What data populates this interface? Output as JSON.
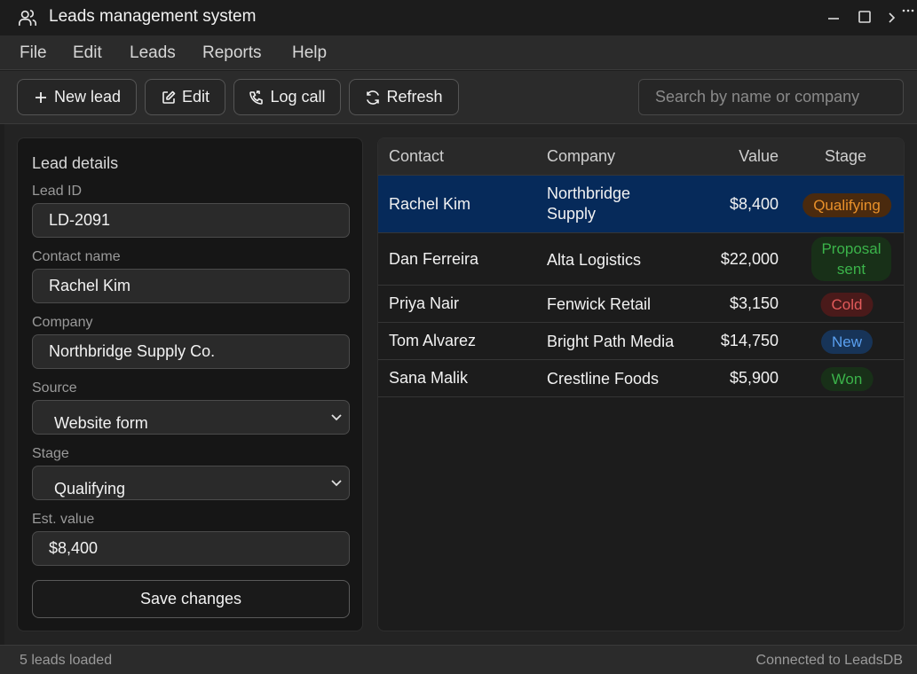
{
  "window": {
    "title": "Leads management system",
    "icon": "users-icon"
  },
  "menu": [
    "File",
    "Edit",
    "Leads",
    "Reports",
    "Help"
  ],
  "toolbar": {
    "new_lead": "New lead",
    "edit": "Edit",
    "log_call": "Log call",
    "refresh": "Refresh",
    "search_placeholder": "Search by name or company"
  },
  "details": {
    "title": "Lead details",
    "lead_id_label": "Lead ID",
    "lead_id": "LD-2091",
    "contact_label": "Contact name",
    "contact": "Rachel Kim",
    "company_label": "Company",
    "company": "Northbridge Supply Co.",
    "source_label": "Source",
    "source": "Website form",
    "stage_label": "Stage",
    "stage": "Qualifying",
    "value_label": "Est. value",
    "value": "$8,400",
    "save": "Save changes"
  },
  "table": {
    "headers": {
      "contact": "Contact",
      "company": "Company",
      "value": "Value",
      "stage": "Stage"
    },
    "rows": [
      {
        "contact": "Rachel Kim",
        "company": "Northbridge Supply",
        "value": "$8,400",
        "stage": "Qualifying",
        "selected": true
      },
      {
        "contact": "Dan Ferreira",
        "company": "Alta Logistics",
        "value": "$22,000",
        "stage": "Proposal sent"
      },
      {
        "contact": "Priya Nair",
        "company": "Fenwick Retail",
        "value": "$3,150",
        "stage": "Cold"
      },
      {
        "contact": "Tom Alvarez",
        "company": "Bright Path Media",
        "value": "$14,750",
        "stage": "New"
      },
      {
        "contact": "Sana Malik",
        "company": "Crestline Foods",
        "value": "$5,900",
        "stage": "Won"
      }
    ]
  },
  "stage_colors": {
    "Qualifying": {
      "fg": "#e8902a",
      "bg": "#4a2a0e"
    },
    "Proposal sent": {
      "fg": "#3bb34a",
      "bg": "#183018"
    },
    "Cold": {
      "fg": "#e35b5b",
      "bg": "#4a1a1a"
    },
    "New": {
      "fg": "#5aa0f0",
      "bg": "#173458"
    },
    "Won": {
      "fg": "#3bb34a",
      "bg": "#183018"
    }
  },
  "status": {
    "left": "5 leads loaded",
    "right": "Connected to LeadsDB"
  }
}
